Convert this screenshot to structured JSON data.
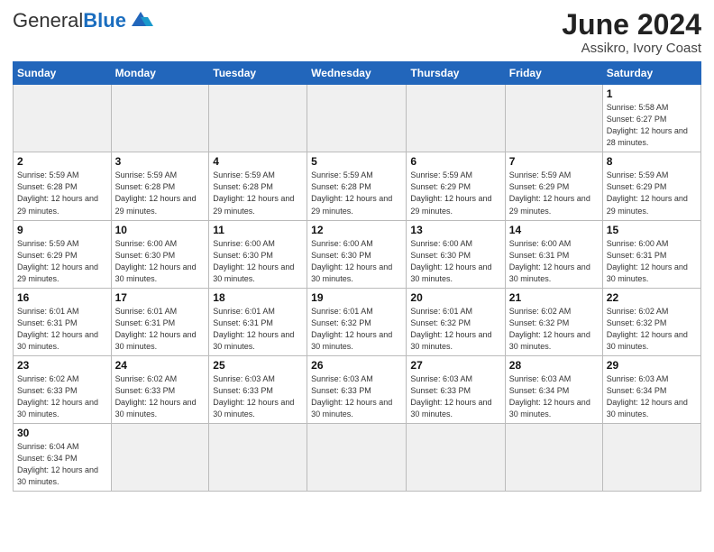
{
  "header": {
    "logo_general": "General",
    "logo_blue": "Blue",
    "month_title": "June 2024",
    "location": "Assikro, Ivory Coast"
  },
  "weekdays": [
    "Sunday",
    "Monday",
    "Tuesday",
    "Wednesday",
    "Thursday",
    "Friday",
    "Saturday"
  ],
  "weeks": [
    [
      {
        "day": "",
        "empty": true
      },
      {
        "day": "",
        "empty": true
      },
      {
        "day": "",
        "empty": true
      },
      {
        "day": "",
        "empty": true
      },
      {
        "day": "",
        "empty": true
      },
      {
        "day": "",
        "empty": true
      },
      {
        "day": "1",
        "sunrise": "5:58 AM",
        "sunset": "6:27 PM",
        "daylight": "12 hours and 28 minutes."
      }
    ],
    [
      {
        "day": "2",
        "sunrise": "5:59 AM",
        "sunset": "6:28 PM",
        "daylight": "12 hours and 29 minutes."
      },
      {
        "day": "3",
        "sunrise": "5:59 AM",
        "sunset": "6:28 PM",
        "daylight": "12 hours and 29 minutes."
      },
      {
        "day": "4",
        "sunrise": "5:59 AM",
        "sunset": "6:28 PM",
        "daylight": "12 hours and 29 minutes."
      },
      {
        "day": "5",
        "sunrise": "5:59 AM",
        "sunset": "6:28 PM",
        "daylight": "12 hours and 29 minutes."
      },
      {
        "day": "6",
        "sunrise": "5:59 AM",
        "sunset": "6:29 PM",
        "daylight": "12 hours and 29 minutes."
      },
      {
        "day": "7",
        "sunrise": "5:59 AM",
        "sunset": "6:29 PM",
        "daylight": "12 hours and 29 minutes."
      },
      {
        "day": "8",
        "sunrise": "5:59 AM",
        "sunset": "6:29 PM",
        "daylight": "12 hours and 29 minutes."
      }
    ],
    [
      {
        "day": "9",
        "sunrise": "5:59 AM",
        "sunset": "6:29 PM",
        "daylight": "12 hours and 29 minutes."
      },
      {
        "day": "10",
        "sunrise": "6:00 AM",
        "sunset": "6:30 PM",
        "daylight": "12 hours and 30 minutes."
      },
      {
        "day": "11",
        "sunrise": "6:00 AM",
        "sunset": "6:30 PM",
        "daylight": "12 hours and 30 minutes."
      },
      {
        "day": "12",
        "sunrise": "6:00 AM",
        "sunset": "6:30 PM",
        "daylight": "12 hours and 30 minutes."
      },
      {
        "day": "13",
        "sunrise": "6:00 AM",
        "sunset": "6:30 PM",
        "daylight": "12 hours and 30 minutes."
      },
      {
        "day": "14",
        "sunrise": "6:00 AM",
        "sunset": "6:31 PM",
        "daylight": "12 hours and 30 minutes."
      },
      {
        "day": "15",
        "sunrise": "6:00 AM",
        "sunset": "6:31 PM",
        "daylight": "12 hours and 30 minutes."
      }
    ],
    [
      {
        "day": "16",
        "sunrise": "6:01 AM",
        "sunset": "6:31 PM",
        "daylight": "12 hours and 30 minutes."
      },
      {
        "day": "17",
        "sunrise": "6:01 AM",
        "sunset": "6:31 PM",
        "daylight": "12 hours and 30 minutes."
      },
      {
        "day": "18",
        "sunrise": "6:01 AM",
        "sunset": "6:31 PM",
        "daylight": "12 hours and 30 minutes."
      },
      {
        "day": "19",
        "sunrise": "6:01 AM",
        "sunset": "6:32 PM",
        "daylight": "12 hours and 30 minutes."
      },
      {
        "day": "20",
        "sunrise": "6:01 AM",
        "sunset": "6:32 PM",
        "daylight": "12 hours and 30 minutes."
      },
      {
        "day": "21",
        "sunrise": "6:02 AM",
        "sunset": "6:32 PM",
        "daylight": "12 hours and 30 minutes."
      },
      {
        "day": "22",
        "sunrise": "6:02 AM",
        "sunset": "6:32 PM",
        "daylight": "12 hours and 30 minutes."
      }
    ],
    [
      {
        "day": "23",
        "sunrise": "6:02 AM",
        "sunset": "6:33 PM",
        "daylight": "12 hours and 30 minutes."
      },
      {
        "day": "24",
        "sunrise": "6:02 AM",
        "sunset": "6:33 PM",
        "daylight": "12 hours and 30 minutes."
      },
      {
        "day": "25",
        "sunrise": "6:03 AM",
        "sunset": "6:33 PM",
        "daylight": "12 hours and 30 minutes."
      },
      {
        "day": "26",
        "sunrise": "6:03 AM",
        "sunset": "6:33 PM",
        "daylight": "12 hours and 30 minutes."
      },
      {
        "day": "27",
        "sunrise": "6:03 AM",
        "sunset": "6:33 PM",
        "daylight": "12 hours and 30 minutes."
      },
      {
        "day": "28",
        "sunrise": "6:03 AM",
        "sunset": "6:34 PM",
        "daylight": "12 hours and 30 minutes."
      },
      {
        "day": "29",
        "sunrise": "6:03 AM",
        "sunset": "6:34 PM",
        "daylight": "12 hours and 30 minutes."
      }
    ],
    [
      {
        "day": "30",
        "sunrise": "6:04 AM",
        "sunset": "6:34 PM",
        "daylight": "12 hours and 30 minutes."
      },
      {
        "day": "",
        "empty": true
      },
      {
        "day": "",
        "empty": true
      },
      {
        "day": "",
        "empty": true
      },
      {
        "day": "",
        "empty": true
      },
      {
        "day": "",
        "empty": true
      },
      {
        "day": "",
        "empty": true
      }
    ]
  ]
}
